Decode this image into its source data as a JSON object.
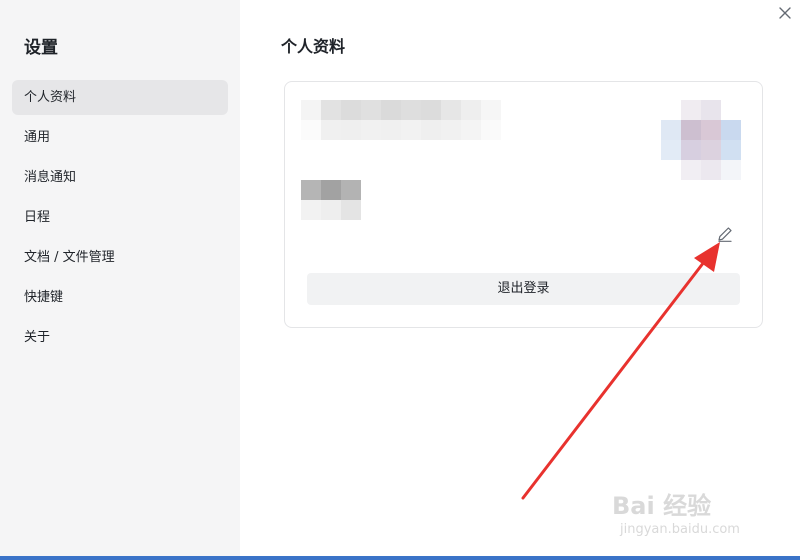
{
  "sidebar": {
    "title": "设置",
    "items": [
      {
        "label": "个人资料",
        "active": true
      },
      {
        "label": "通用",
        "active": false
      },
      {
        "label": "消息通知",
        "active": false
      },
      {
        "label": "日程",
        "active": false
      },
      {
        "label": "文档 / 文件管理",
        "active": false
      },
      {
        "label": "快捷键",
        "active": false
      },
      {
        "label": "关于",
        "active": false
      }
    ]
  },
  "main": {
    "title": "个人资料",
    "profile": {
      "name_pixelated": true,
      "id_pixelated": true,
      "avatar_pixelated": true,
      "logout_label": "退出登录"
    }
  },
  "icons": {
    "close": "close-icon",
    "edit": "pencil-icon"
  },
  "annotation": {
    "color": "#e8322e"
  },
  "watermark": {
    "text": "Bai 经验",
    "url": "jingyan.baidu.com"
  },
  "colors": {
    "sidebar_bg": "#f5f5f6",
    "active_item_bg": "#e6e6e8",
    "button_bg": "#f1f2f3",
    "arrow_red": "#e8322e"
  }
}
